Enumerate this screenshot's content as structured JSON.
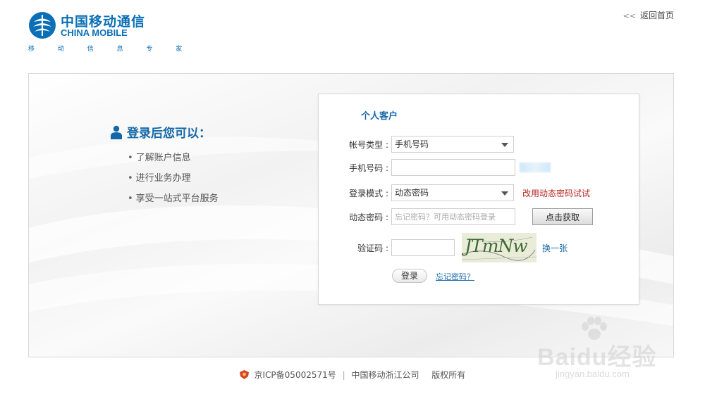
{
  "brand": {
    "name_cn": "中国移动通信",
    "name_en": "CHINA MOBILE",
    "subtitle": "移 动 信 息 专 家"
  },
  "header": {
    "back_label": "返回首页"
  },
  "benefits": {
    "title": "登录后您可以：",
    "items": [
      "了解账户信息",
      "进行业务办理",
      "享受一站式平台服务"
    ]
  },
  "login": {
    "title": "个人客户",
    "account_type": {
      "label": "帐号类型",
      "value": "手机号码"
    },
    "phone": {
      "label": "手机号码",
      "value": ""
    },
    "login_mode": {
      "label": "登录模式",
      "value": "动态密码",
      "alt_link": "改用动态密码试试"
    },
    "dynamic_password": {
      "label": "动态密码",
      "placeholder": "忘记密码？可用动态密码登录",
      "get_button": "点击获取"
    },
    "captcha": {
      "label": "验证码",
      "value": "",
      "image_text": "JTmNw",
      "refresh": "换一张"
    },
    "login_button": "登录",
    "forgot_link": "忘记密码？"
  },
  "footer": {
    "icp": "京ICP备05002571号",
    "company": "中国移动浙江公司",
    "rights": "版权所有"
  },
  "watermark": {
    "brand": "Baidu经验",
    "url": "jingyan.baidu.com"
  },
  "colors": {
    "brand_blue": "#0a6fb6",
    "link_blue": "#1468a8",
    "alert_red": "#b4261f"
  }
}
